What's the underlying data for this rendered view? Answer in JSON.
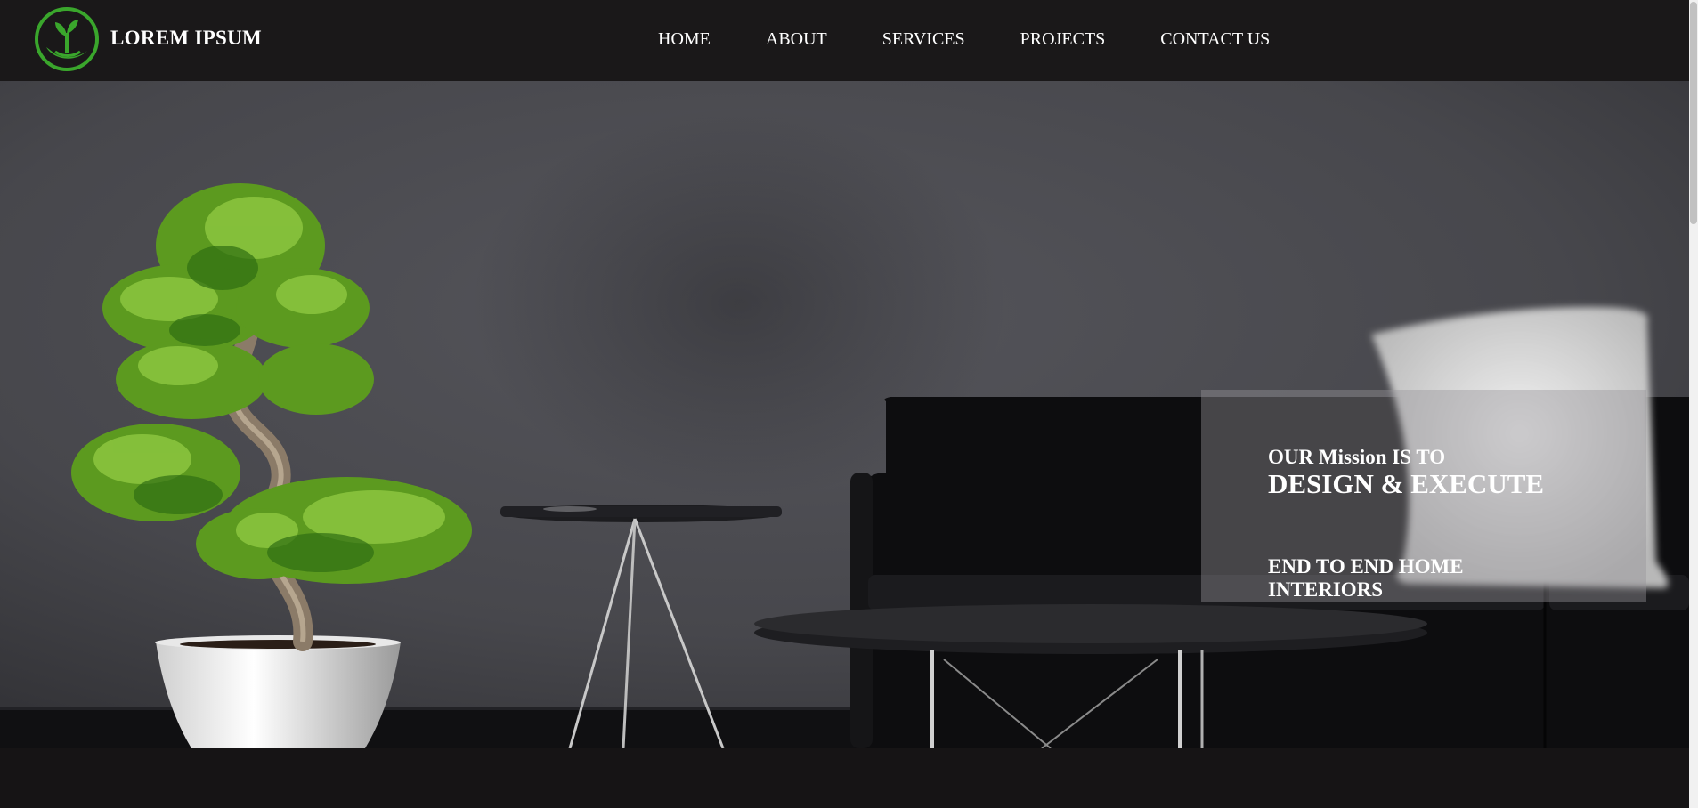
{
  "header": {
    "brand": "LOREM IPSUM",
    "logo_icon": "sprout-in-hand-icon",
    "logo_color": "#3aa62c"
  },
  "nav": {
    "items": [
      "HOME",
      "ABOUT",
      "SERVICES",
      "PROJECTS",
      "CONTACT US"
    ]
  },
  "hero": {
    "mission_line1": "OUR Mission IS TO",
    "mission_line2": "DESIGN & EXECUTE",
    "mission_line3": "END TO END HOME INTERIORS"
  },
  "colors": {
    "header_bg": "#1a1819",
    "wall": "#4d4d52",
    "text": "#ffffff"
  }
}
